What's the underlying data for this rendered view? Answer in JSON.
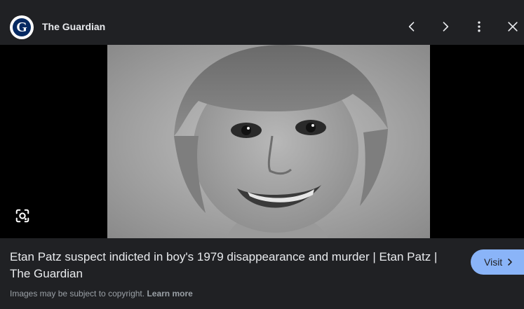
{
  "source": {
    "name": "The Guardian",
    "logo_letter": "G",
    "logo_colors": {
      "ring": "#ffffff",
      "fill": "#052962"
    }
  },
  "controls": {
    "icons": [
      "chevron-left-icon",
      "chevron-right-icon",
      "more-vert-icon",
      "close-icon"
    ]
  },
  "image": {
    "subject": "black-and-white portrait photograph",
    "lens_icon": "google-lens-icon"
  },
  "caption": {
    "title": "Etan Patz suspect indicted in boy's 1979 disappearance and murder | Etan Patz | The Guardian"
  },
  "visit": {
    "label": "Visit",
    "color": "#8ab4f8"
  },
  "footer": {
    "notice": "Images may be subject to copyright.",
    "learn_more": "Learn more"
  },
  "colors": {
    "background": "#202124",
    "text": "#e8eaed",
    "muted": "#9aa0a6"
  }
}
